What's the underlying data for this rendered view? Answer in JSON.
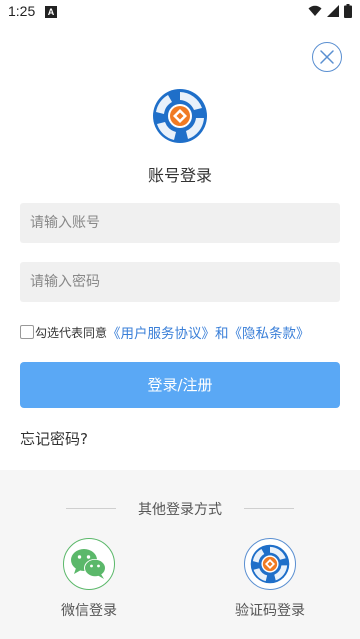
{
  "status_bar": {
    "time": "1:25",
    "notification_icon": "a-notification-icon",
    "icons": [
      "wifi-icon",
      "signal-icon",
      "battery-icon"
    ]
  },
  "close_icon": "close-icon",
  "logo": {
    "icon": "app-logo-icon",
    "colors": {
      "ring": "#1f6fc9",
      "center": "#f07a23"
    }
  },
  "page_title": "账号登录",
  "account_input": {
    "placeholder": "请输入账号",
    "value": ""
  },
  "password_input": {
    "placeholder": "请输入密码",
    "value": ""
  },
  "agreement": {
    "checked": false,
    "prefix": "勾选代表同意",
    "user_agreement": "《用户服务协议》",
    "and": "和",
    "privacy_policy": "《隐私条款》"
  },
  "login_button": "登录/注册",
  "forgot_password": "忘记密码?",
  "other_login": {
    "title": "其他登录方式",
    "options": [
      {
        "label": "微信登录",
        "icon": "wechat-icon"
      },
      {
        "label": "验证码登录",
        "icon": "app-logo-icon"
      }
    ]
  },
  "colors": {
    "accent": "#5aa8f5",
    "link": "#3a7fd8",
    "wechat": "#5bb86a",
    "input_bg": "#f0f0f0",
    "panel_bg": "#f6f6f6"
  }
}
